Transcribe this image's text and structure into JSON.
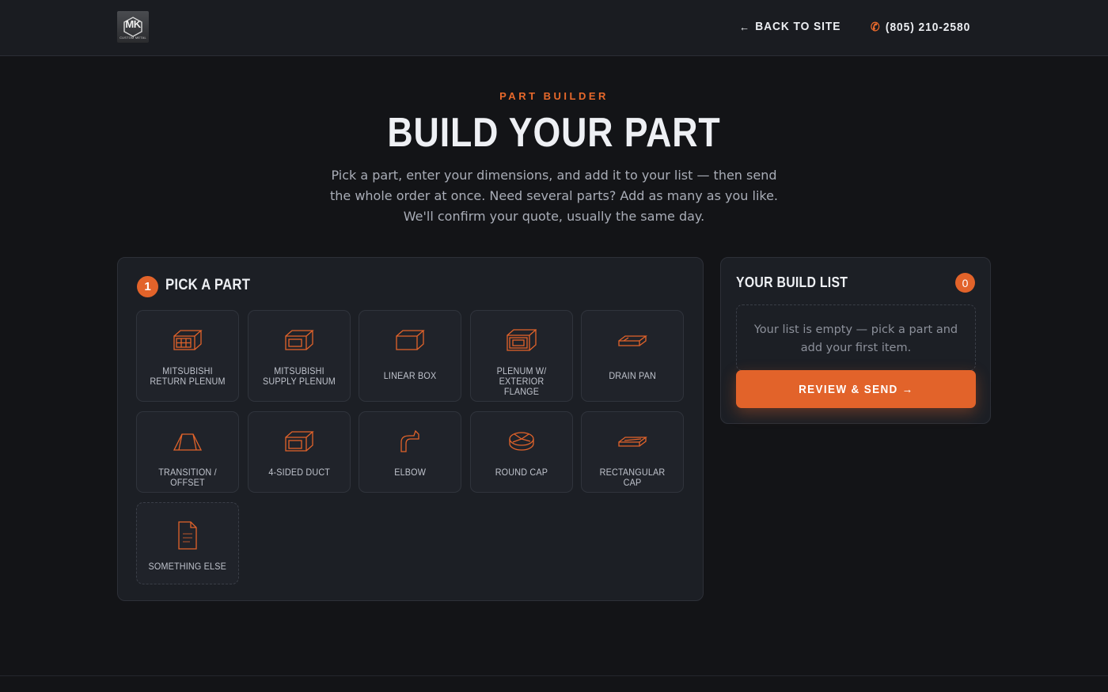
{
  "header": {
    "logo_text": "MK",
    "logo_sub": "CUSTOM METAL",
    "back_label": "BACK TO SITE",
    "phone_label": "(805) 210-2580"
  },
  "hero": {
    "eyebrow": "PART BUILDER",
    "title": "BUILD YOUR PART",
    "subtitle": "Pick a part, enter your dimensions, and add it to your list — then send the whole order at once. Need several parts? Add as many as you like. We'll confirm your quote, usually the same day."
  },
  "picker": {
    "step_number": "1",
    "title": "PICK A PART",
    "parts": [
      {
        "label": "MITSUBISHI RETURN PLENUM",
        "icon": "return-plenum-icon"
      },
      {
        "label": "MITSUBISHI SUPPLY PLENUM",
        "icon": "supply-plenum-icon"
      },
      {
        "label": "LINEAR BOX",
        "icon": "linear-box-icon"
      },
      {
        "label": "PLENUM W/ EXTERIOR FLANGE",
        "icon": "flange-plenum-icon"
      },
      {
        "label": "DRAIN PAN",
        "icon": "drain-pan-icon"
      },
      {
        "label": "TRANSITION / OFFSET",
        "icon": "transition-icon"
      },
      {
        "label": "4-SIDED DUCT",
        "icon": "duct-icon"
      },
      {
        "label": "ELBOW",
        "icon": "elbow-icon"
      },
      {
        "label": "ROUND CAP",
        "icon": "round-cap-icon"
      },
      {
        "label": "RECTANGULAR CAP",
        "icon": "rect-cap-icon"
      },
      {
        "label": "SOMETHING ELSE",
        "icon": "document-icon"
      }
    ]
  },
  "build_list": {
    "title": "YOUR BUILD LIST",
    "count": "0",
    "empty_text": "Your list is empty — pick a part and add your first item.",
    "review_label": "REVIEW & SEND →"
  },
  "colors": {
    "accent": "#e2632a",
    "background": "#131417",
    "panel": "#1c1f25"
  }
}
